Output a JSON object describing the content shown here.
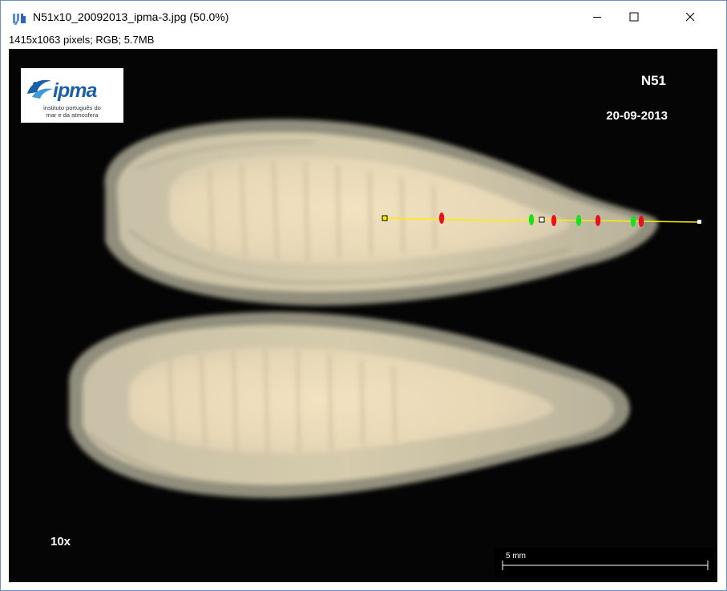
{
  "window": {
    "title": "N51x10_20092013_ipma-3.jpg (50.0%)",
    "info": "1415x1063 pixels; RGB; 5.7MB",
    "icon": "imagej-icon",
    "controls": [
      "minimize-icon",
      "maximize-icon",
      "close-icon"
    ]
  },
  "image": {
    "logo": {
      "word": "ipma",
      "line1": "instituto português do",
      "line2": "mar e da atmosfera"
    },
    "sample_id": "N51",
    "date": "20-09-2013",
    "magnification": "10x",
    "scale_bar": "5 mm"
  },
  "colors": {
    "measure_line": "#ffee00",
    "marker_red": "#e8101a",
    "marker_green": "#19e11e",
    "background": "#050505",
    "window_border": "#6b8fc0"
  }
}
